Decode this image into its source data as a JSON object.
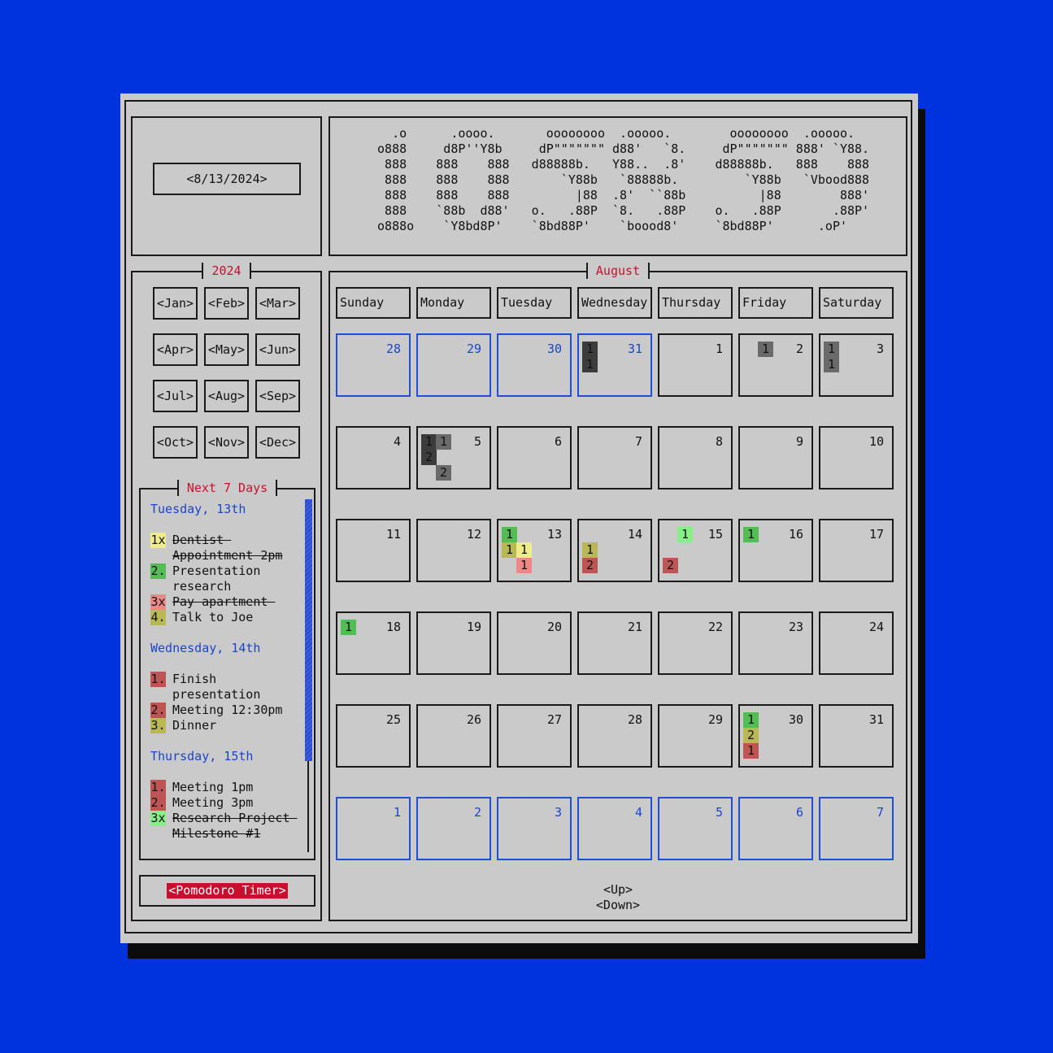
{
  "current_date": "<8/13/2024>",
  "banner": "   .o      .oooo.       oooooooo  .ooooo.        oooooooo  .ooooo.  \n o888     d8P''Y8b     dP\"\"\"\"\"\"\" d88'   `8.     dP\"\"\"\"\"\"\" 888' `Y88. \n  888    888    888   d88888b.   Y88..  .8'    d88888b.   888    888 \n  888    888    888       `Y88b   `88888b.         `Y88b   `Vbood888 \n  888    888    888         |88  .8'  ``88b          |88        888' \n  888    `88b  d88'   o.   .88P  `8.   .88P    o.   .88P       .88P' \n o888o    `Y8bd8P'    `8bd88P'    `boood8'     `8bd88P'      .oP'    ",
  "year": "2024",
  "months": [
    "<Jan>",
    "<Feb>",
    "<Mar>",
    "<Apr>",
    "<May>",
    "<Jun>",
    "<Jul>",
    "<Aug>",
    "<Sep>",
    "<Oct>",
    "<Nov>",
    "<Dec>"
  ],
  "agenda_title": "Next 7 Days",
  "agenda": [
    {
      "type": "head",
      "text": "Tuesday, 13th"
    },
    {
      "type": "item",
      "mark": "1x",
      "color": "#f0ec8a",
      "text": "Dentist \nAppointment 2pm",
      "done": true
    },
    {
      "type": "item",
      "mark": "2.",
      "color": "#55bb55",
      "text": "Presentation\nresearch",
      "done": false
    },
    {
      "type": "item",
      "mark": "3x",
      "color": "#ee8888",
      "text": "Pay apartment ",
      "done": true
    },
    {
      "type": "item",
      "mark": "4.",
      "color": "#b9b854",
      "text": "Talk to Joe",
      "done": false
    },
    {
      "type": "head",
      "text": "Wednesday, 14th"
    },
    {
      "type": "item",
      "mark": "1.",
      "color": "#bd5555",
      "text": "Finish\npresentation",
      "done": false
    },
    {
      "type": "item",
      "mark": "2.",
      "color": "#bd5555",
      "text": "Meeting 12:30pm",
      "done": false
    },
    {
      "type": "item",
      "mark": "3.",
      "color": "#b9b854",
      "text": "Dinner",
      "done": false
    },
    {
      "type": "head",
      "text": "Thursday, 15th"
    },
    {
      "type": "item",
      "mark": "1.",
      "color": "#bd5555",
      "text": "Meeting 1pm",
      "done": false
    },
    {
      "type": "item",
      "mark": "2.",
      "color": "#bd5555",
      "text": "Meeting 3pm",
      "done": false
    },
    {
      "type": "item",
      "mark": "3x",
      "color": "#88ee88",
      "text": "Research Project \nMilestone #1",
      "done": true
    }
  ],
  "pomodoro_label": "<Pomodoro Timer>",
  "month_title": "August",
  "weekdays": [
    "Sunday",
    "Monday",
    "Tuesday",
    "Wednesday",
    "Thursday",
    "Friday",
    "Saturday"
  ],
  "weeks": [
    [
      {
        "d": "28",
        "other": true
      },
      {
        "d": "29",
        "other": true
      },
      {
        "d": "30",
        "other": true
      },
      {
        "d": "31",
        "other": true,
        "chips": [
          {
            "t": "1",
            "c": "#3c3c3c",
            "col": 0,
            "row": 0
          },
          {
            "t": "1",
            "c": "#3c3c3c",
            "col": 0,
            "row": 1
          }
        ]
      },
      {
        "d": "1"
      },
      {
        "d": "2",
        "chips": [
          {
            "t": "1",
            "c": "#6a6a6a",
            "col": 1,
            "row": 0
          }
        ]
      },
      {
        "d": "3",
        "chips": [
          {
            "t": "1",
            "c": "#6a6a6a",
            "col": 0,
            "row": 0
          },
          {
            "t": "1",
            "c": "#6a6a6a",
            "col": 0,
            "row": 1
          }
        ]
      }
    ],
    [
      {
        "d": "4"
      },
      {
        "d": "5",
        "chips": [
          {
            "t": "1",
            "c": "#3c3c3c",
            "col": 0,
            "row": 0
          },
          {
            "t": "1",
            "c": "#6a6a6a",
            "col": 1,
            "row": 0
          },
          {
            "t": "2",
            "c": "#3c3c3c",
            "col": 0,
            "row": 1
          },
          {
            "t": "2",
            "c": "#6a6a6a",
            "col": 1,
            "row": 2
          }
        ]
      },
      {
        "d": "6"
      },
      {
        "d": "7"
      },
      {
        "d": "8"
      },
      {
        "d": "9"
      },
      {
        "d": "10"
      }
    ],
    [
      {
        "d": "11"
      },
      {
        "d": "12"
      },
      {
        "d": "13",
        "chips": [
          {
            "t": "1",
            "c": "#55bb55",
            "col": 0,
            "row": 0
          },
          {
            "t": "1",
            "c": "#b9b854",
            "col": 0,
            "row": 1
          },
          {
            "t": "1",
            "c": "#f0ec8a",
            "col": 1,
            "row": 1
          },
          {
            "t": "1",
            "c": "#ee8888",
            "col": 1,
            "row": 2
          }
        ]
      },
      {
        "d": "14",
        "chips": [
          {
            "t": "1",
            "c": "#b9b854",
            "col": 0,
            "row": 1
          },
          {
            "t": "2",
            "c": "#bd5555",
            "col": 0,
            "row": 2
          }
        ]
      },
      {
        "d": "15",
        "chips": [
          {
            "t": "1",
            "c": "#88ee88",
            "col": 1,
            "row": 0
          },
          {
            "t": "2",
            "c": "#bd5555",
            "col": 0,
            "row": 2
          }
        ]
      },
      {
        "d": "16",
        "chips": [
          {
            "t": "1",
            "c": "#55bb55",
            "col": 0,
            "row": 0
          }
        ]
      },
      {
        "d": "17"
      }
    ],
    [
      {
        "d": "18",
        "chips": [
          {
            "t": "1",
            "c": "#55bb55",
            "col": 0,
            "row": 0
          }
        ]
      },
      {
        "d": "19"
      },
      {
        "d": "20"
      },
      {
        "d": "21"
      },
      {
        "d": "22"
      },
      {
        "d": "23"
      },
      {
        "d": "24"
      }
    ],
    [
      {
        "d": "25"
      },
      {
        "d": "26"
      },
      {
        "d": "27"
      },
      {
        "d": "28"
      },
      {
        "d": "29"
      },
      {
        "d": "30",
        "chips": [
          {
            "t": "1",
            "c": "#55bb55",
            "col": 0,
            "row": 0
          },
          {
            "t": "2",
            "c": "#b9b854",
            "col": 0,
            "row": 1
          },
          {
            "t": "1",
            "c": "#bd5555",
            "col": 0,
            "row": 2
          }
        ]
      },
      {
        "d": "31"
      }
    ],
    [
      {
        "d": "1",
        "other": true
      },
      {
        "d": "2",
        "other": true
      },
      {
        "d": "3",
        "other": true
      },
      {
        "d": "4",
        "other": true
      },
      {
        "d": "5",
        "other": true
      },
      {
        "d": "6",
        "other": true
      },
      {
        "d": "7",
        "other": true
      }
    ]
  ],
  "nav_up": "<Up>",
  "nav_down": "<Down>"
}
